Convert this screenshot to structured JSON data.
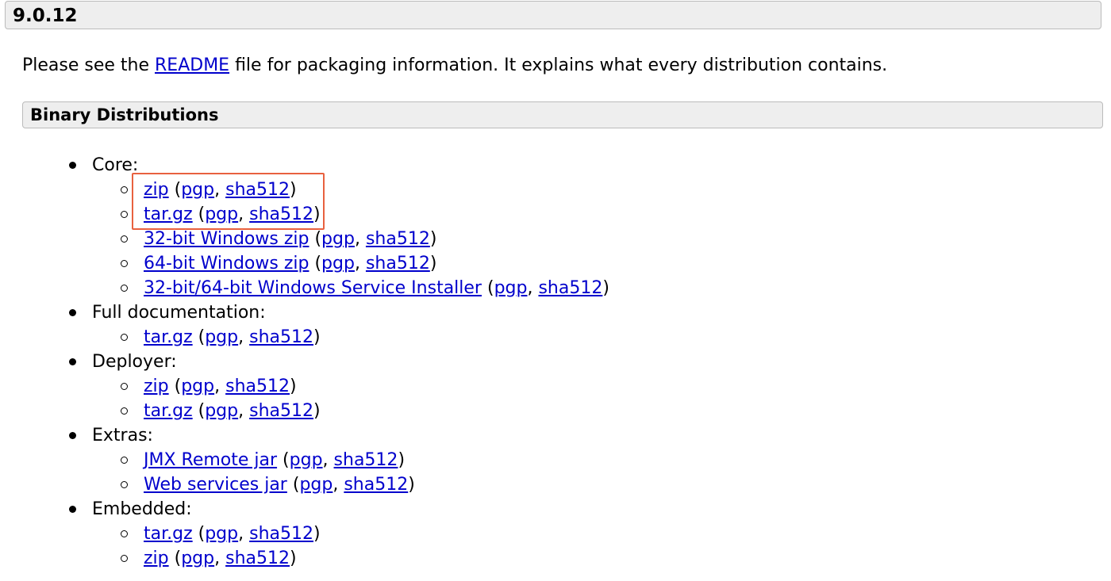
{
  "version": "9.0.12",
  "intro": {
    "before": "Please see the ",
    "link": "README",
    "after": " file for packaging information. It explains what every distribution contains."
  },
  "section_title": "Binary Distributions",
  "punct": {
    "open": " (",
    "sep": ", ",
    "close": ")"
  },
  "groups": [
    {
      "label": "Core:",
      "items": [
        {
          "name": "zip",
          "pgp": "pgp",
          "sha": "sha512"
        },
        {
          "name": "tar.gz",
          "pgp": "pgp",
          "sha": "sha512"
        },
        {
          "name": "32-bit Windows zip",
          "pgp": "pgp",
          "sha": "sha512"
        },
        {
          "name": "64-bit Windows zip",
          "pgp": "pgp",
          "sha": "sha512"
        },
        {
          "name": "32-bit/64-bit Windows Service Installer",
          "pgp": "pgp",
          "sha": "sha512"
        }
      ]
    },
    {
      "label": "Full documentation:",
      "items": [
        {
          "name": "tar.gz",
          "pgp": "pgp",
          "sha": "sha512"
        }
      ]
    },
    {
      "label": "Deployer:",
      "items": [
        {
          "name": "zip",
          "pgp": "pgp",
          "sha": "sha512"
        },
        {
          "name": "tar.gz",
          "pgp": "pgp",
          "sha": "sha512"
        }
      ]
    },
    {
      "label": "Extras:",
      "items": [
        {
          "name": "JMX Remote jar",
          "pgp": "pgp",
          "sha": "sha512"
        },
        {
          "name": "Web services jar",
          "pgp": "pgp",
          "sha": "sha512"
        }
      ]
    },
    {
      "label": "Embedded:",
      "items": [
        {
          "name": "tar.gz",
          "pgp": "pgp",
          "sha": "sha512"
        },
        {
          "name": "zip",
          "pgp": "pgp",
          "sha": "sha512"
        }
      ]
    }
  ],
  "highlight_color": "#e8613f",
  "link_color": "#0000cc"
}
